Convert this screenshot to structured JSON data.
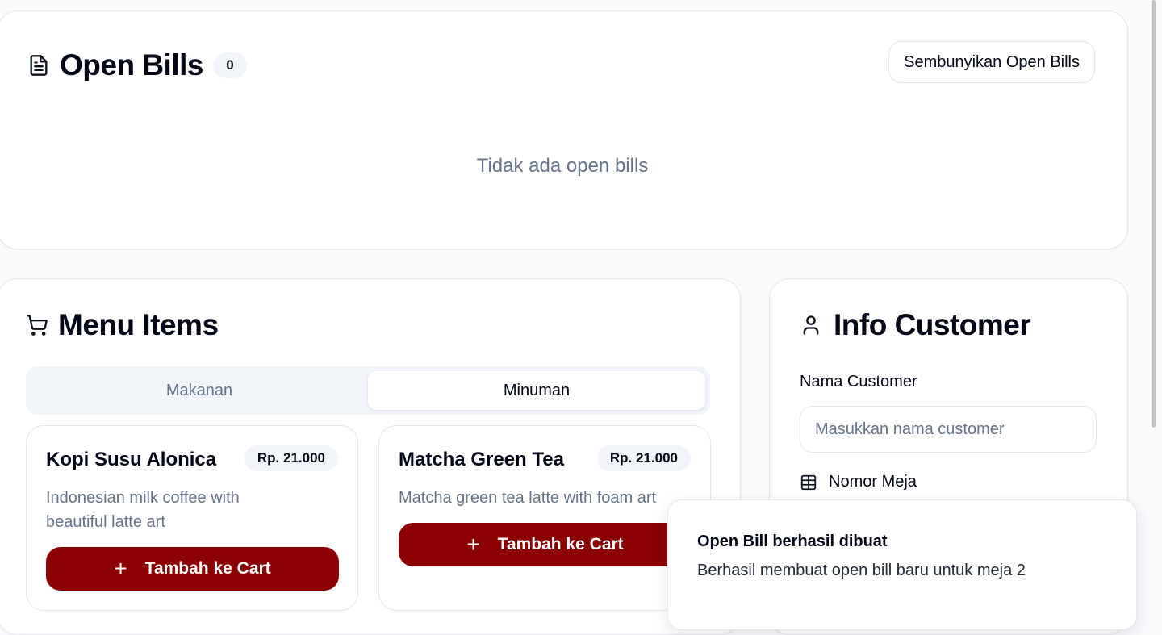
{
  "open_bills": {
    "icon": "file-text-icon",
    "title": "Open Bills",
    "count": "0",
    "hide_button": "Sembunyikan Open Bills",
    "empty_text": "Tidak ada open bills"
  },
  "menu": {
    "icon": "cart-icon",
    "title": "Menu Items",
    "tabs": [
      {
        "label": "Makanan",
        "active": false
      },
      {
        "label": "Minuman",
        "active": true
      }
    ],
    "items": [
      {
        "name": "Kopi Susu Alonica",
        "price": "Rp. 21.000",
        "description": "Indonesian milk coffee with beautiful latte art",
        "button": "Tambah ke Cart"
      },
      {
        "name": "Matcha Green Tea",
        "price": "Rp. 21.000",
        "description": "Matcha green tea latte with foam art",
        "button": "Tambah ke Cart"
      }
    ]
  },
  "customer": {
    "icon": "user-icon",
    "title": "Info Customer",
    "name_label": "Nama Customer",
    "name_placeholder": "Masukkan nama customer",
    "name_value": "",
    "table_icon": "table-grid-icon",
    "table_label": "Nomor Meja"
  },
  "toast": {
    "title": "Open Bill berhasil dibuat",
    "description": "Berhasil membuat open bill baru untuk meja 2"
  },
  "colors": {
    "accent": "#8b0000",
    "muted_text": "#64748b",
    "border": "#e5e7eb",
    "tab_bg": "#f1f5f9"
  }
}
